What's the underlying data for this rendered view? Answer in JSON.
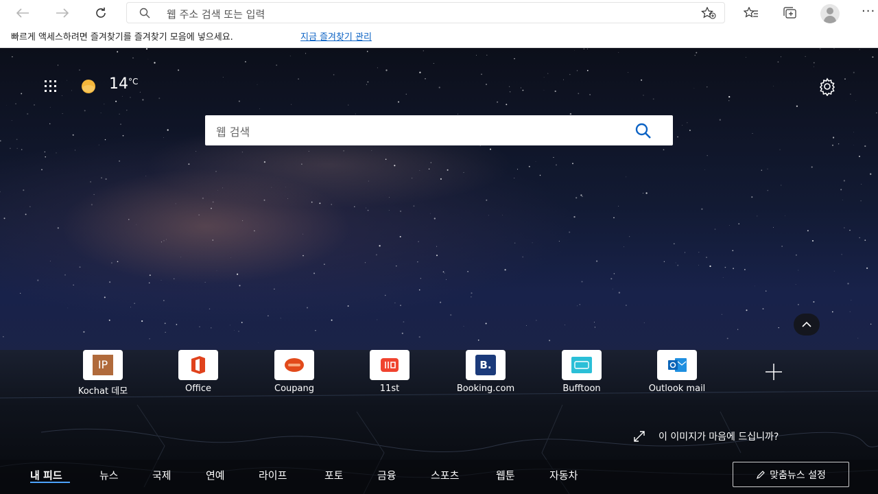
{
  "browser": {
    "address_placeholder": "웹 주소 검색 또는 입력",
    "favorites_bar_message": "빠르게 액세스하려면 즐겨찾기를 즐겨찾기 모음에 넣으세요.",
    "favorites_bar_link": "지금 즐겨찾기 관리",
    "more_label": "···"
  },
  "newtab": {
    "temperature": "14",
    "temperature_unit": "°C",
    "search_placeholder": "웹 검색",
    "tiles": [
      {
        "label": "Kochat 데모"
      },
      {
        "label": "Office"
      },
      {
        "label": "Coupang"
      },
      {
        "label": "11st"
      },
      {
        "label": "Booking.com"
      },
      {
        "label": "Bufftoon"
      },
      {
        "label": "Outlook mail"
      }
    ],
    "image_feedback": "이 이미지가 마음에 드십니까?",
    "tabs": [
      "내 피드",
      "뉴스",
      "국제",
      "연예",
      "라이프",
      "포토",
      "금융",
      "스포츠",
      "웹툰",
      "자동차"
    ],
    "personalize_button": "맞춤뉴스 설정",
    "icons": {
      "tile_1_text": "IP",
      "tile_5_text": "B."
    }
  },
  "colors": {
    "link": "#0b62c4",
    "active_tab_underline": "#4da3ff"
  }
}
